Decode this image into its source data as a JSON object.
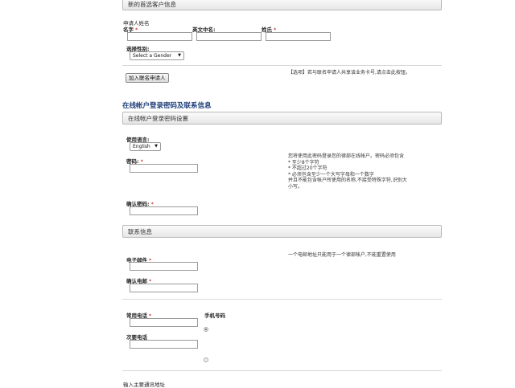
{
  "applicant": {
    "section_title": "新的首选客户信息",
    "name_label": "申请人姓名",
    "first_name_label": "名字",
    "english_name_label": "英文中名:",
    "last_name_label": "姓氏",
    "required_mark": "*",
    "gender_label": "选择性别:",
    "gender_value": "Select a Gender",
    "add_coapplicant_button": "加入联名申请人",
    "coapplicant_hint": "【选项】若与联名申请人共享该业务卡号,请点击此按钮。"
  },
  "online_account": {
    "heading": "在线帐户登录密码及联系信息",
    "section_title": "在线帐户登录密码设置",
    "language_label": "使用语言:",
    "language_value": "English",
    "password_label": "密码:",
    "password_hint_lines": [
      "您将使用此密码登录您的律部在线帐户。密码必须包含",
      "* 至少8个字符",
      "* 不超过20个字符",
      "* 必须包含至少一个大写字母和一个数字",
      "并且不能包含帐户所使用的名称,不接受特殊字符,识别大",
      "小写。"
    ],
    "confirm_password_label": "确认密码:"
  },
  "contact": {
    "section_title": "联系信息",
    "email_label": "电子邮件",
    "email_hint": "一个电邮地址只能用于一个律部帐户,不能重置使用",
    "confirm_email_label": "确认电邮",
    "primary_phone_label": "常用电话",
    "mobile_label": "手机号码",
    "secondary_phone_label": "次要电话",
    "address_label": "输入主要通讯地址"
  }
}
